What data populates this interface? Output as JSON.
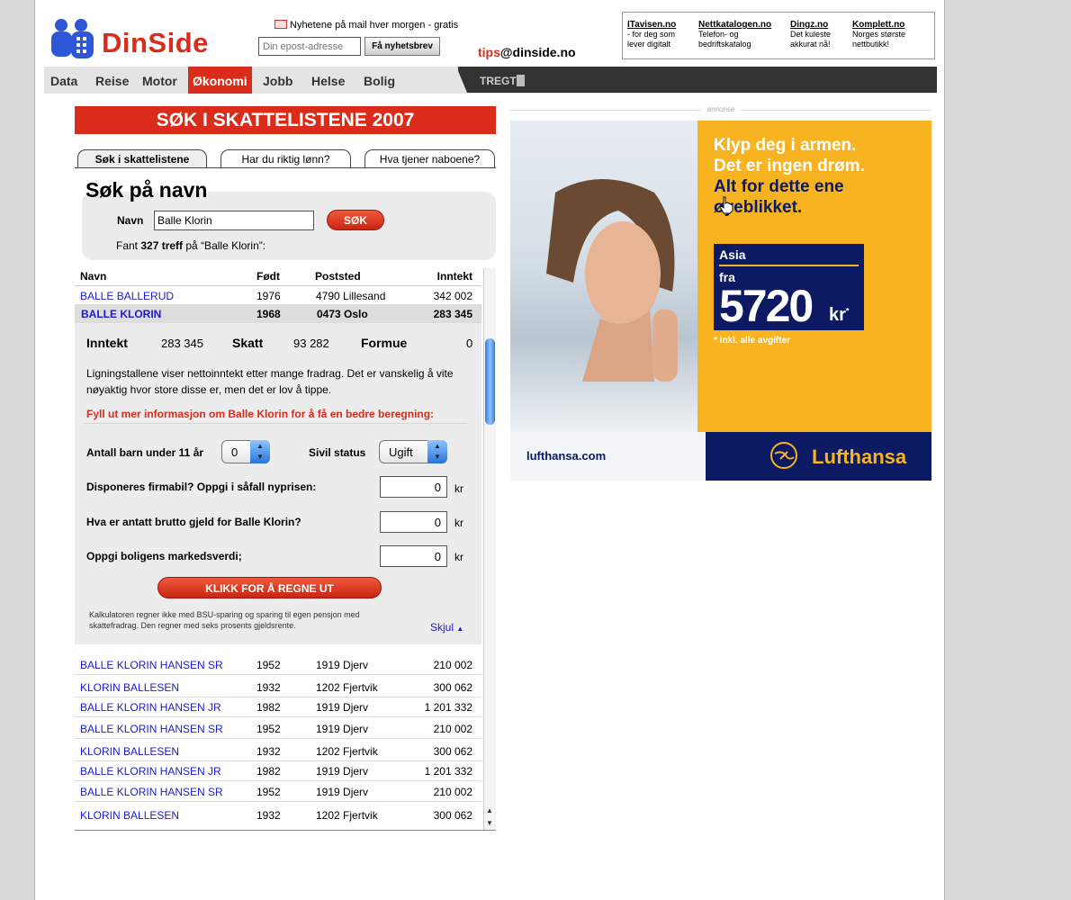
{
  "header": {
    "logo_text": "DinSide",
    "newsletter_label": "Nyhetene på mail hver morgen - gratis",
    "newsletter_placeholder": "Din epost-adresse",
    "newsletter_button": "Få nyhetsbrev",
    "tips_red": "tips",
    "tips_rest": "@dinside.no",
    "partners": [
      {
        "name": "ITavisen.no",
        "desc": "- for deg som lever digitalt"
      },
      {
        "name": "Nettkatalogen.no",
        "desc": "Telefon- og bedriftskatalog"
      },
      {
        "name": "Dingz.no",
        "desc": "Det kuleste akkurat nå!"
      },
      {
        "name": "Komplett.no",
        "desc": "Norges største nettbutikk!"
      }
    ]
  },
  "nav": {
    "items": [
      "Data",
      "Reise",
      "Motor",
      "Økonomi",
      "Jobb",
      "Helse",
      "Bolig"
    ],
    "active": "Økonomi",
    "ticker": "TREGT"
  },
  "left": {
    "banner": "SØK I SKATTELISTENE 2007",
    "tabs": [
      "Søk i skattelistene",
      "Har du riktig lønn?",
      "Hva tjener naboene?"
    ],
    "search_title": "Søk på navn",
    "name_label": "Navn",
    "name_value": "Balle Klorin",
    "search_button": "SØK",
    "hits_prefix": "Fant ",
    "hits_count": "327 treff",
    "hits_suffix": " på “Balle Klorin”:",
    "columns": [
      "Navn",
      "Født",
      "Poststed",
      "Inntekt"
    ],
    "rows_top": [
      {
        "name": "BALLE BALLERUD",
        "year": "1976",
        "place": "4790 Lillesand",
        "income": "342 002"
      },
      {
        "name": "BALLE KLORIN",
        "year": "1968",
        "place": "0473 Oslo",
        "income": "283 345"
      }
    ],
    "detail": {
      "income_label": "Inntekt",
      "income_value": "283 345",
      "tax_label": "Skatt",
      "tax_value": "93 282",
      "wealth_label": "Formue",
      "wealth_value": "0",
      "info_line1": "Ligningstallene viser nettoinntekt etter mange fradrag. Det er vanskelig å vite",
      "info_line2": "nøyaktig hvor store disse er, men det er lov å tippe.",
      "prompt": "Fyll ut mer informasjon om Balle Klorin for å få en bedre beregning:",
      "children_label": "Antall barn under 11 år",
      "children_value": "0",
      "civil_label": "Sivil status",
      "civil_value": "Ugift",
      "car_label": "Disponeres firmabil?  Oppgi i såfall  nyprisen:",
      "car_value": "0",
      "debt_label": "Hva er antatt brutto gjeld for Balle Klorin?",
      "debt_value": "0",
      "home_label": "Oppgi boligens markedsverdi;",
      "home_value": "0",
      "unit": "kr",
      "calc_button": "KLIKK FOR Å REGNE UT",
      "note_line1": "Kalkulatoren regner ikke med BSU-sparing og sparing til egen pensjon med",
      "note_line2": "skattefradrag. Den regner med seks prosents gjeldsrente.",
      "hide": "Skjul"
    },
    "rows_bottom": [
      {
        "name": "BALLE KLORIN HANSEN SR",
        "year": "1952",
        "place": "1919 Djerv",
        "income": "210 002"
      },
      {
        "name": "KLORIN BALLESEN",
        "year": "1932",
        "place": "1202 Fjertvik",
        "income": "300 062"
      },
      {
        "name": "BALLE KLORIN HANSEN JR",
        "year": "1982",
        "place": "1919 Djerv",
        "income": "1 201 332"
      },
      {
        "name": "BALLE KLORIN HANSEN SR",
        "year": "1952",
        "place": "1919 Djerv",
        "income": "210 002"
      },
      {
        "name": "KLORIN BALLESEN",
        "year": "1932",
        "place": "1202 Fjertvik",
        "income": "300 062"
      },
      {
        "name": "BALLE KLORIN HANSEN JR",
        "year": "1982",
        "place": "1919 Djerv",
        "income": "1 201 332"
      },
      {
        "name": "BALLE KLORIN HANSEN SR",
        "year": "1952",
        "place": "1919 Djerv",
        "income": "210 002"
      },
      {
        "name": "KLORIN BALLESEN",
        "year": "1932",
        "place": "1202 Fjertvik",
        "income": "300 062"
      }
    ]
  },
  "ad": {
    "label": "annonse",
    "headline_white": [
      "Klyp deg i armen.",
      "Det er ingen drøm."
    ],
    "headline_blue": [
      "Alt for dette ene",
      "øyeblikket."
    ],
    "region": "Asia",
    "from": "fra",
    "price": "5720",
    "currency": "kr",
    "asterisk": "*",
    "note": "* inkl. alle avgifter",
    "url": "lufthansa.com",
    "brand": "Lufthansa",
    "colors": {
      "yellow": "#f7b320",
      "navy": "#0b1a63"
    }
  }
}
